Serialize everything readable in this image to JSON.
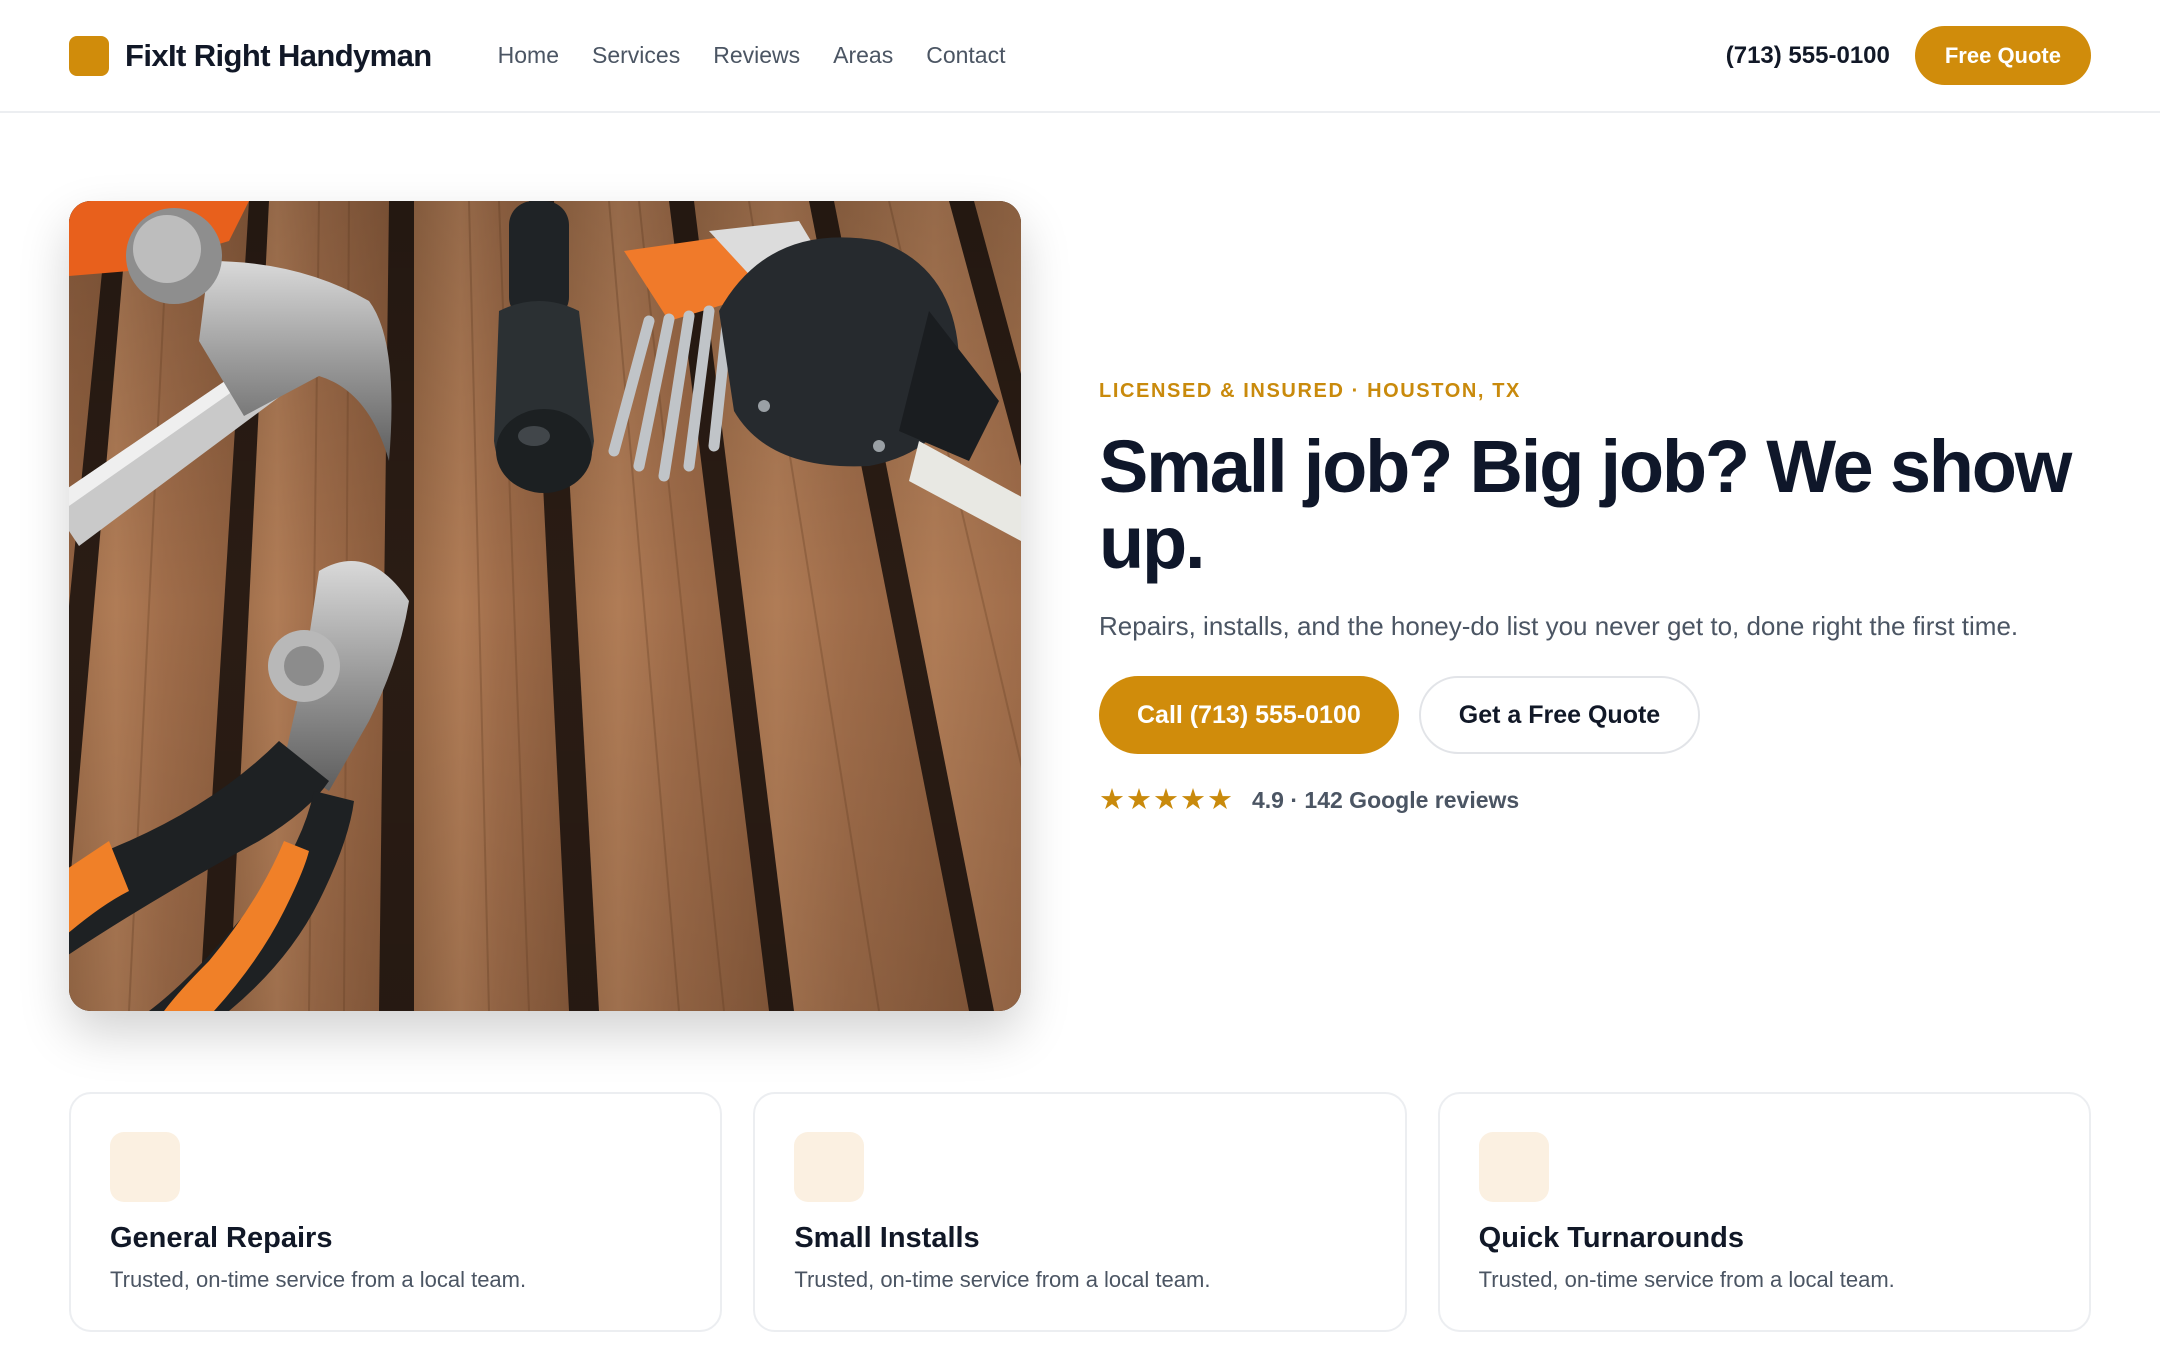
{
  "header": {
    "brand": "FixIt Right Handyman",
    "nav": [
      "Home",
      "Services",
      "Reviews",
      "Areas",
      "Contact"
    ],
    "phone": "(713) 555-0100",
    "quote_button": "Free Quote"
  },
  "hero": {
    "image_alt": "Hammer, pliers, screwdriver, hex keys and tape measure on a wooden slat table",
    "eyebrow": "LICENSED & INSURED · HOUSTON, TX",
    "headline": "Small job? Big job? We show up.",
    "subline": "Repairs, installs, and the honey-do list you never get to, done right the first time.",
    "cta_primary": "Call (713) 555-0100",
    "cta_secondary": "Get a Free Quote",
    "stars": "★★★★★",
    "rating_text": "4.9 · 142 Google reviews",
    "rating_value": 4.9,
    "review_count": 142
  },
  "features": [
    {
      "title": "General Repairs",
      "description": "Trusted, on-time service from a local team."
    },
    {
      "title": "Small Installs",
      "description": "Trusted, on-time service from a local team."
    },
    {
      "title": "Quick Turnarounds",
      "description": "Trusted, on-time service from a local team."
    }
  ],
  "colors": {
    "accent": "#d08c0b",
    "accent_text": "#c98a0c",
    "heading": "#0f172a",
    "body_text": "#4b5563",
    "icon_tint": "#fbf0e1",
    "border": "#eceef1"
  }
}
